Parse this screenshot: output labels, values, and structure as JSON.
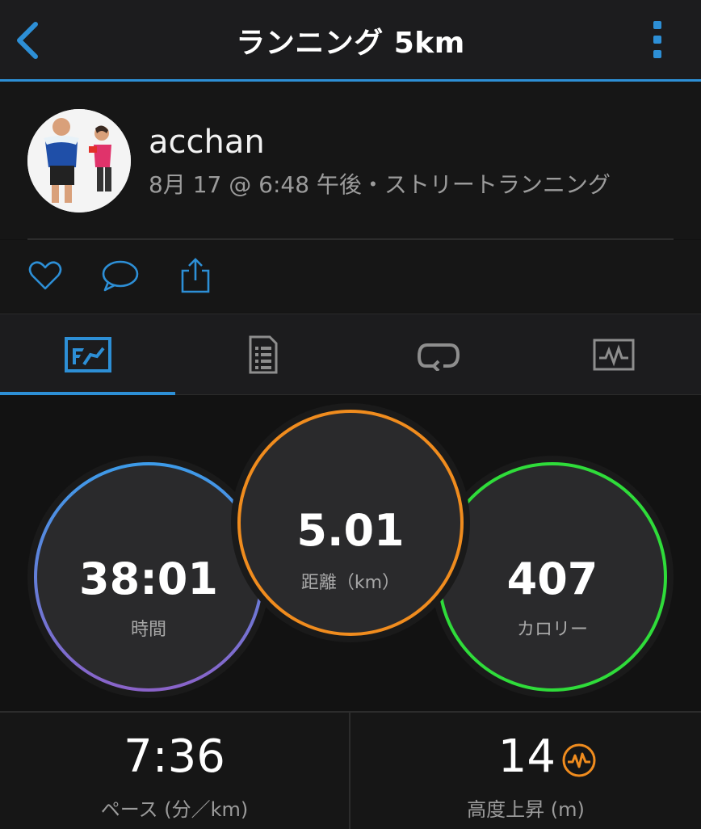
{
  "header": {
    "title": "ランニング 5km"
  },
  "profile": {
    "username": "acchan",
    "meta": "8月 17 @ 6:48 午後・ストリートランニング"
  },
  "actions": [
    "heart-icon",
    "comment-icon",
    "share-icon"
  ],
  "tabs": [
    "overview-icon",
    "details-icon",
    "laps-icon",
    "chart-icon"
  ],
  "stats": {
    "time": {
      "value": "38:01",
      "label": "時間"
    },
    "distance": {
      "value": "5.01",
      "label": "距離（km）"
    },
    "calories": {
      "value": "407",
      "label": "カロリー"
    }
  },
  "bottom": {
    "pace": {
      "value": "7:36",
      "label": "ペース (分／km)"
    },
    "elevation": {
      "value": "14",
      "label": "高度上昇 (m)"
    }
  },
  "colors": {
    "accent": "#2d8fd6",
    "time_ring_start": "#3d9be9",
    "time_ring_end": "#8a63c9",
    "distance_ring": "#f08c1e",
    "calories_ring": "#2fdc3a"
  }
}
